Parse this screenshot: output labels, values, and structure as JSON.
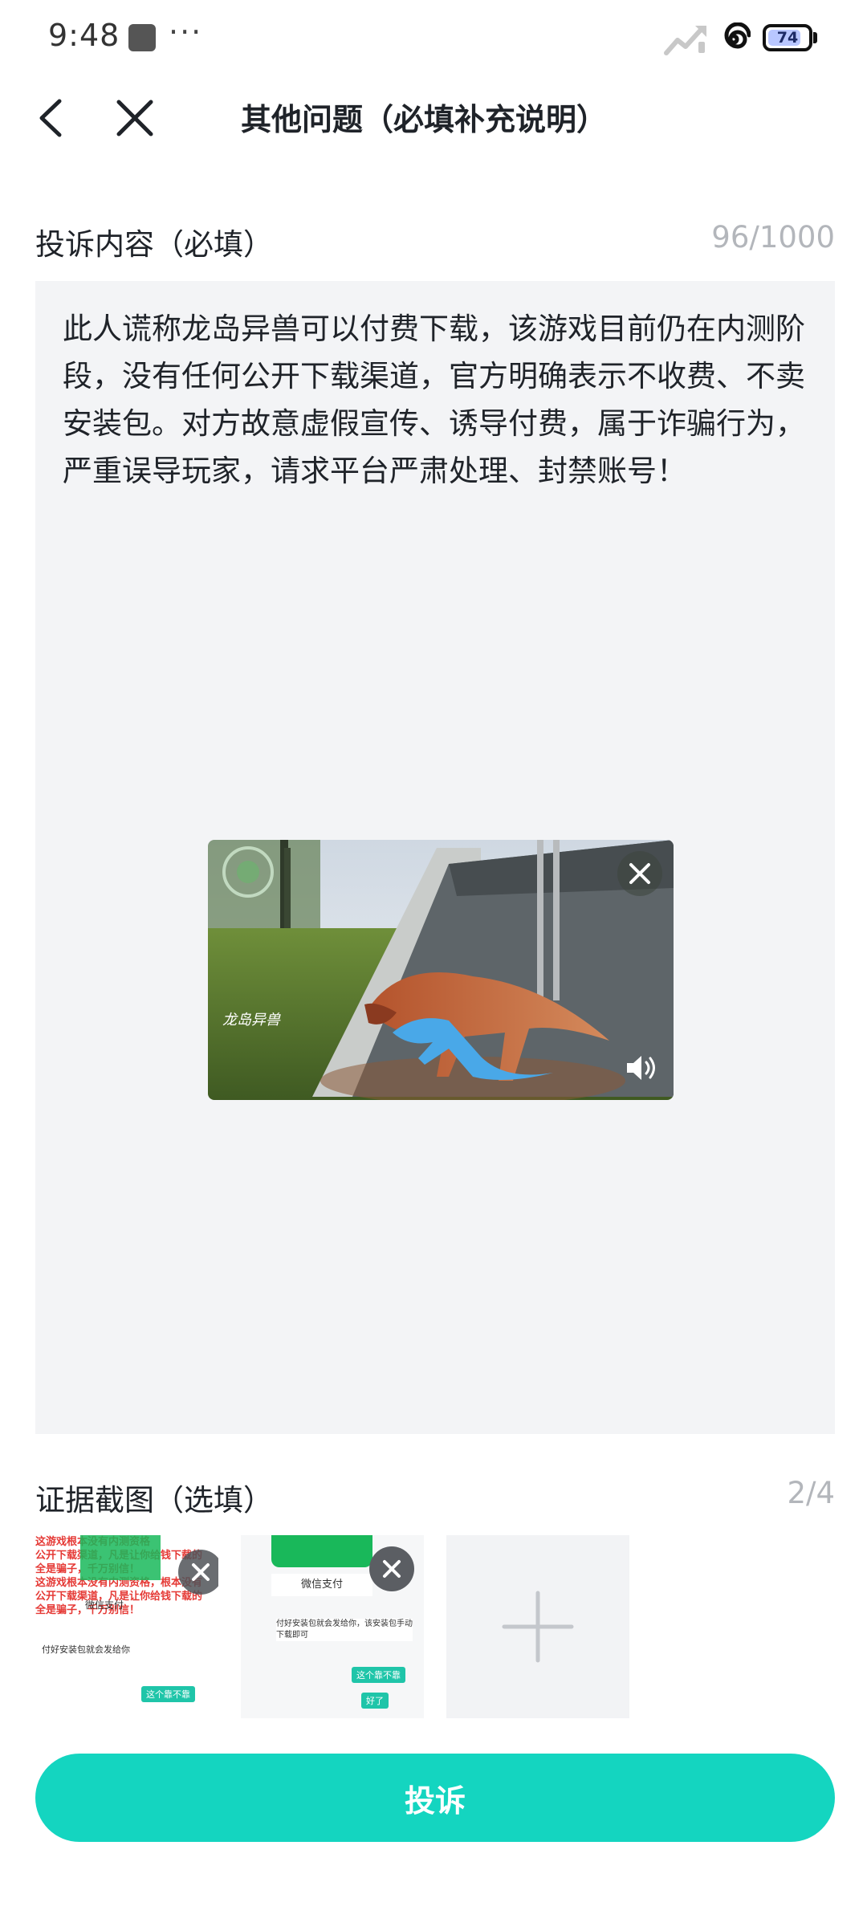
{
  "status_bar": {
    "time": "9:48",
    "more": "···",
    "battery_level": "74",
    "icons": [
      "app-notification-icon",
      "more-dots-icon",
      "signal-icon",
      "swirl-app-icon",
      "battery-icon"
    ]
  },
  "header": {
    "back_icon": "back-arrow-icon",
    "close_icon": "close-icon",
    "title": "其他问题（必填补充说明）"
  },
  "complaint": {
    "label": "投诉内容（必填）",
    "counter": "96/1000",
    "text": "此人谎称龙岛异兽可以付费下载，该游戏目前仍在内测阶段，没有任何公开下载渠道，官方明确表示不收费、不卖安装包。对方故意虚假宣传、诱导付费，属于诈骗行为，严重误导玩家，请求平台严肃处理、封禁账号！",
    "video": {
      "watermark": "龙岛异兽",
      "close_icon": "close-icon",
      "volume_icon": "volume-icon"
    }
  },
  "evidence": {
    "label": "证据截图（选填）",
    "counter": "2/4",
    "thumbs": [
      {
        "lines": [
          "这游戏根本没有内测资格",
          "公开下载渠道，凡是让你给钱下载的",
          "全是骗子，千万别信！",
          "这游戏根本没有内测资格，根本没有",
          "公开下载渠道，凡是让你给钱下载的",
          "全是骗子，千万别信！"
        ],
        "pay_label": "微信支付",
        "chat_line": "付好安装包就会发给你",
        "chat_bubble": "这个靠不靠"
      },
      {
        "header": "微信支付",
        "chat_line": "付好安装包就会发给你，该安装包手动下载即可",
        "chat_bubbles": [
          "这个靠不靠",
          "好了"
        ]
      }
    ],
    "add_icon": "plus-icon"
  },
  "submit": {
    "label": "投诉"
  },
  "colors": {
    "accent": "#14d5c0",
    "panel_bg": "#f3f4f6",
    "muted": "#b3b6bb"
  }
}
